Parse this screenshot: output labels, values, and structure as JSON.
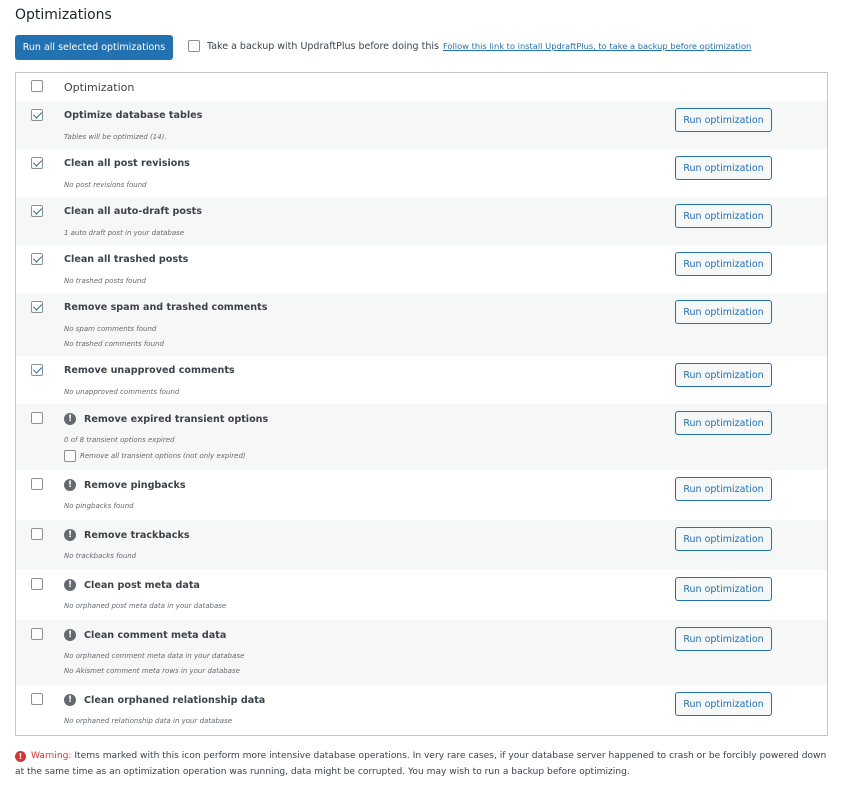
{
  "header": {
    "title": "Optimizations",
    "run_all_label": "Run all selected optimizations",
    "backup_text": "Take a backup with UpdraftPlus before doing this",
    "backup_link": "Follow this link to install UpdraftPlus, to take a backup before optimization"
  },
  "table": {
    "column_header": "Optimization",
    "run_label": "Run optimization",
    "rows": [
      {
        "name": "Optimize database tables",
        "checked": true,
        "warning": false,
        "details": [
          "Tables will be optimized (14)."
        ]
      },
      {
        "name": "Clean all post revisions",
        "checked": true,
        "warning": false,
        "details": [
          "No post revisions found"
        ]
      },
      {
        "name": "Clean all auto-draft posts",
        "checked": true,
        "warning": false,
        "details": [
          "1 auto draft post in your database"
        ]
      },
      {
        "name": "Clean all trashed posts",
        "checked": true,
        "warning": false,
        "details": [
          "No trashed posts found"
        ]
      },
      {
        "name": "Remove spam and trashed comments",
        "checked": true,
        "warning": false,
        "details": [
          "No spam comments found",
          "No trashed comments found"
        ]
      },
      {
        "name": "Remove unapproved comments",
        "checked": true,
        "warning": false,
        "details": [
          "No unapproved comments found"
        ]
      },
      {
        "name": "Remove expired transient options",
        "checked": false,
        "warning": true,
        "details": [
          "0 of 8 transient options expired"
        ],
        "option_label": "Remove all transient options (not only expired)"
      },
      {
        "name": "Remove pingbacks",
        "checked": false,
        "warning": true,
        "details": [
          "No pingbacks found"
        ]
      },
      {
        "name": "Remove trackbacks",
        "checked": false,
        "warning": true,
        "details": [
          "No trackbacks found"
        ]
      },
      {
        "name": "Clean post meta data",
        "checked": false,
        "warning": true,
        "details": [
          "No orphaned post meta data in your database"
        ]
      },
      {
        "name": "Clean comment meta data",
        "checked": false,
        "warning": true,
        "details": [
          "No orphaned comment meta data in your database",
          "No Akismet comment meta rows in your database"
        ]
      },
      {
        "name": "Clean orphaned relationship data",
        "checked": false,
        "warning": true,
        "details": [
          "No orphaned relationship data in your database"
        ]
      }
    ]
  },
  "footer": {
    "warning_label": "Warning:",
    "warning_text": "Items marked with this icon perform more intensive database operations. In very rare cases, if your database server happened to crash or be forcibly powered down at the same time as an optimization operation was running, data might be corrupted. You may wish to run a backup before optimizing."
  },
  "icons": {
    "warning_icon": "exclamation-circle",
    "checkbox_icon": "checkmark"
  },
  "colors": {
    "accent": "#2271b1",
    "warning": "#d63638",
    "row_alt": "#f6f7f7",
    "border": "#c3c4c7"
  }
}
